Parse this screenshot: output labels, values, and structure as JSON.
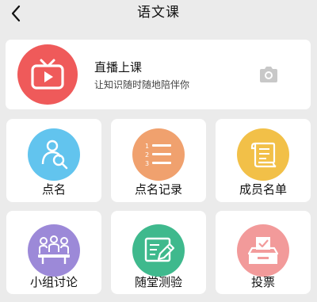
{
  "header": {
    "title": "语文课"
  },
  "live": {
    "title": "直播上课",
    "subtitle": "让知识随时随地陪伴你"
  },
  "tiles": [
    {
      "label": "点名",
      "icon": "person-search-icon",
      "color": "#62c4ee"
    },
    {
      "label": "点名记录",
      "icon": "numbered-list-icon",
      "color": "#f0a16e"
    },
    {
      "label": "成员名单",
      "icon": "scroll-list-icon",
      "color": "#f2c048"
    },
    {
      "label": "小组讨论",
      "icon": "group-meeting-icon",
      "color": "#9c89d8"
    },
    {
      "label": "随堂测验",
      "icon": "quiz-pen-icon",
      "color": "#3fb98d"
    },
    {
      "label": "投票",
      "icon": "ballot-box-icon",
      "color": "#f29a9a"
    }
  ],
  "colors": {
    "live_accent": "#ef5a5a",
    "background": "#ebebeb"
  }
}
